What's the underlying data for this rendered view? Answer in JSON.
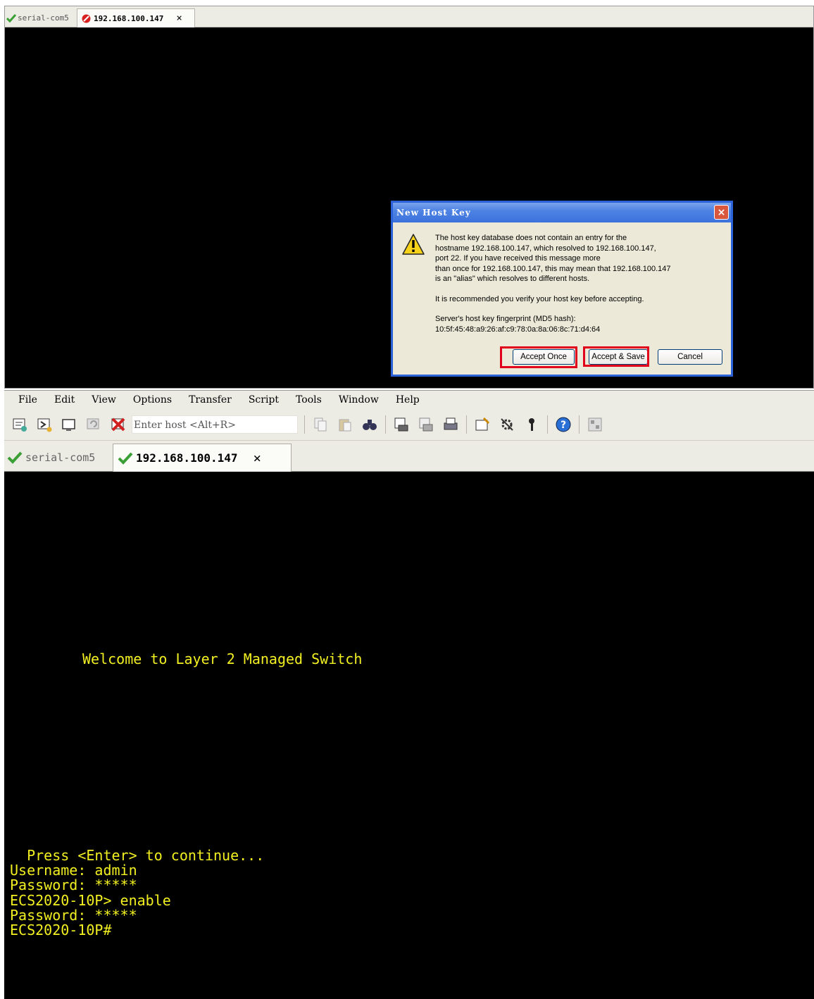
{
  "top_window": {
    "tabs": [
      {
        "label": "serial-com5",
        "status": "connected-icon"
      },
      {
        "label": "192.168.100.147",
        "status": "disconnected-icon",
        "close": "×"
      }
    ]
  },
  "dialog": {
    "title": "New Host Key",
    "close": "×",
    "lines": [
      "The host key database does not contain an entry for the",
      "hostname 192.168.100.147, which resolved to 192.168.100.147,",
      "port 22.  If you have received this message more",
      "than once for 192.168.100.147, this may mean that 192.168.100.147",
      "is an \"alias\" which resolves to different hosts."
    ],
    "recommend": "It is recommended you verify your host key before accepting.",
    "fingerprint_label": "Server's host key fingerprint (MD5 hash):",
    "fingerprint": "10:5f:45:48:a9:26:af:c9:78:0a:8a:06:8c:71:d4:64",
    "buttons": {
      "accept_once": "Accept Once",
      "accept_save": "Accept & Save",
      "cancel": "Cancel"
    },
    "highlight_color": "#e0001a"
  },
  "bottom_window": {
    "menu": [
      "File",
      "Edit",
      "View",
      "Options",
      "Transfer",
      "Script",
      "Tools",
      "Window",
      "Help"
    ],
    "host_placeholder": "Enter host <Alt+R>",
    "tabs": [
      {
        "label": "serial-com5",
        "status": "connected-icon"
      },
      {
        "label": "192.168.100.147",
        "status": "connected-icon",
        "close": "×"
      }
    ],
    "terminal": {
      "color": "#f2f021",
      "welcome": "Welcome to Layer 2 Managed Switch",
      "lines": [
        "  Press <Enter> to continue...",
        "Username: admin",
        "Password: *****",
        "ECS2020-10P> enable",
        "Password: *****",
        "ECS2020-10P#"
      ]
    }
  }
}
